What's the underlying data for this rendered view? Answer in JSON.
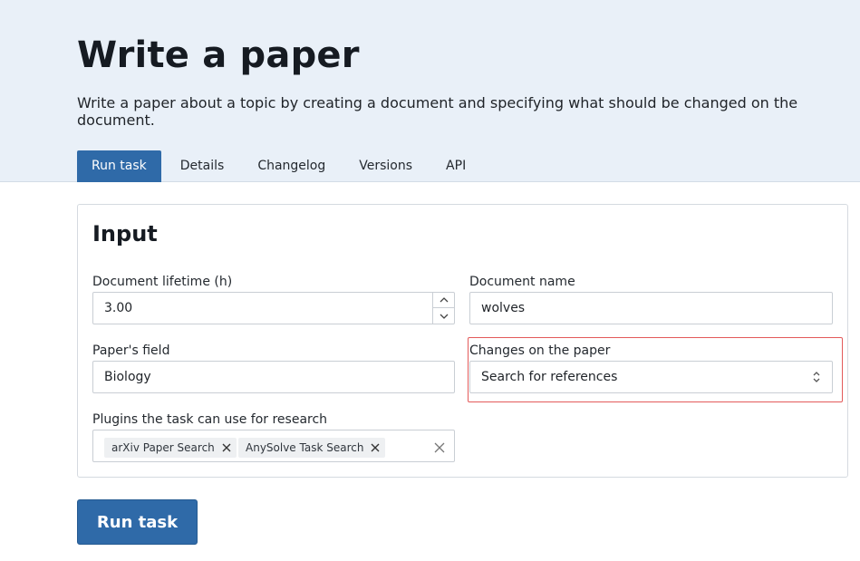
{
  "header": {
    "title": "Write a paper",
    "description": "Write a paper about a topic by creating a document and specifying what should be changed on the document."
  },
  "tabs": [
    {
      "label": "Run task",
      "active": true
    },
    {
      "label": "Details",
      "active": false
    },
    {
      "label": "Changelog",
      "active": false
    },
    {
      "label": "Versions",
      "active": false
    },
    {
      "label": "API",
      "active": false
    }
  ],
  "form": {
    "title": "Input",
    "lifetime": {
      "label": "Document lifetime (h)",
      "value": "3.00"
    },
    "doc_name": {
      "label": "Document name",
      "value": "wolves"
    },
    "field": {
      "label": "Paper's field",
      "value": "Biology"
    },
    "changes": {
      "label": "Changes on the paper",
      "value": "Search for references"
    },
    "plugins": {
      "label": "Plugins the task can use for research",
      "chips": [
        "arXiv Paper Search",
        "AnySolve Task Search"
      ]
    }
  },
  "actions": {
    "run_label": "Run task"
  },
  "colors": {
    "accent": "#2f6aa8",
    "hero_bg": "#e9f0f8",
    "highlight": "#e35a5a"
  }
}
